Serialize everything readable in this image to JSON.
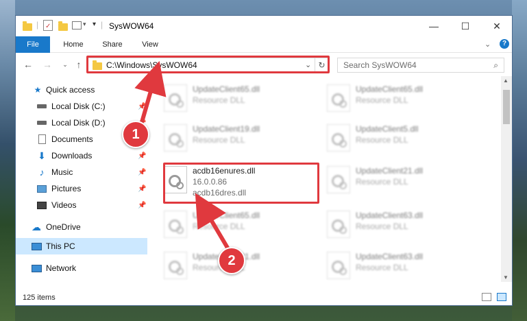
{
  "window": {
    "title": "SysWOW64",
    "controls": {
      "minimize": "—",
      "maximize": "☐",
      "close": "✕"
    }
  },
  "ribbon": {
    "tabs": [
      "File",
      "Home",
      "Share",
      "View"
    ]
  },
  "address": {
    "path": "C:\\Windows\\SysWOW64",
    "search_placeholder": "Search SysWOW64"
  },
  "nav": {
    "items": [
      {
        "label": "Quick access",
        "icon": "star-icon"
      },
      {
        "label": "Local Disk (C:)",
        "icon": "drive-icon",
        "pinned": true
      },
      {
        "label": "Local Disk (D:)",
        "icon": "drive-icon",
        "pinned": true
      },
      {
        "label": "Documents",
        "icon": "documents-icon",
        "pinned": true
      },
      {
        "label": "Downloads",
        "icon": "downloads-icon",
        "pinned": true
      },
      {
        "label": "Music",
        "icon": "music-icon",
        "pinned": true
      },
      {
        "label": "Pictures",
        "icon": "pictures-icon",
        "pinned": true
      },
      {
        "label": "Videos",
        "icon": "videos-icon",
        "pinned": true
      },
      {
        "label": "OneDrive",
        "icon": "onedrive-icon"
      },
      {
        "label": "This PC",
        "icon": "pc-icon",
        "selected": true
      },
      {
        "label": "Network",
        "icon": "network-icon"
      }
    ]
  },
  "files": {
    "left": [
      {
        "name": "UpdateClient65.dll",
        "sub": "Resource DLL"
      },
      {
        "name": "UpdateClient19.dll",
        "sub": "Resource DLL"
      },
      {
        "name": "acdb16enures.dll",
        "sub": "16.0.0.86",
        "sub2": "acdb16dres.dll"
      },
      {
        "name": "UpdateClient65.dll",
        "sub": "Resource DLL"
      },
      {
        "name": "UpdateClient21.dll",
        "sub": "Resource DLL"
      }
    ],
    "right": [
      {
        "name": "UpdateClient65.dll",
        "sub": "Resource DLL"
      },
      {
        "name": "UpdateClient5.dll",
        "sub": "Resource DLL"
      },
      {
        "name": "UpdateClient21.dll",
        "sub": "Resource DLL"
      },
      {
        "name": "UpdateClient63.dll",
        "sub": "Resource DLL"
      },
      {
        "name": "UpdateClient63.dll",
        "sub": "Resource DLL"
      }
    ]
  },
  "status": {
    "item_count": "125 items"
  },
  "annotations": {
    "step1": "1",
    "step2": "2"
  },
  "colors": {
    "accent": "#1979ca",
    "highlight": "#e0393e",
    "selected": "#cce8ff"
  }
}
